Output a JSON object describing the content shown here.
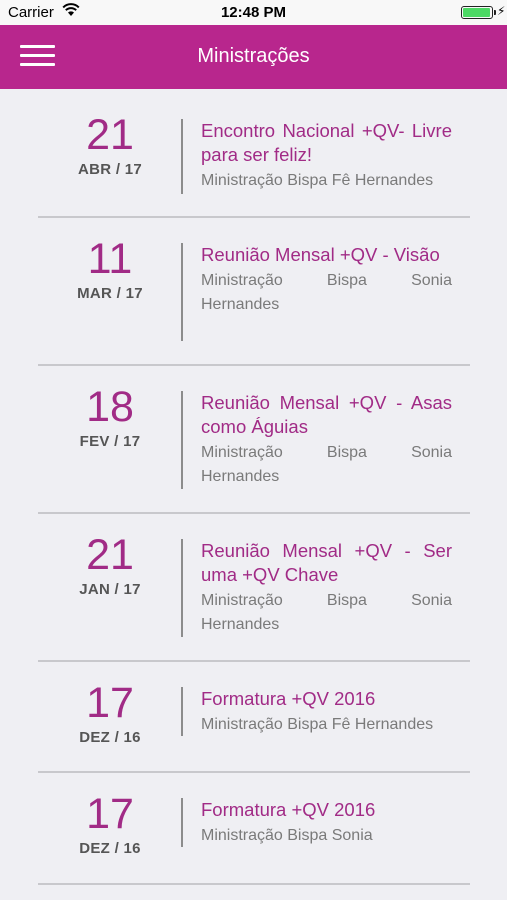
{
  "status_bar": {
    "carrier": "Carrier",
    "time": "12:48 PM"
  },
  "nav": {
    "title": "Ministrações"
  },
  "items": [
    {
      "day": "21",
      "month": "ABR / 17",
      "title": "Encontro Nacional +QV- Livre para ser feliz!",
      "subtitle": "Ministração Bispa Fê Hernandes"
    },
    {
      "day": "11",
      "month": "MAR / 17",
      "title": "Reunião Mensal +QV - Visão",
      "subtitle": "Ministração Bispa Sonia Hernandes"
    },
    {
      "day": "18",
      "month": "FEV / 17",
      "title": "Reunião Mensal +QV - Asas como Águias",
      "subtitle": "Ministração Bispa Sonia Hernandes"
    },
    {
      "day": "21",
      "month": "JAN / 17",
      "title": "Reunião Mensal +QV - Ser uma +QV Chave",
      "subtitle": "Ministração Bispa Sonia Hernandes"
    },
    {
      "day": "17",
      "month": "DEZ / 16",
      "title": "Formatura +QV 2016",
      "subtitle": "Ministração Bispa Fê Hernandes"
    },
    {
      "day": "17",
      "month": "DEZ / 16",
      "title": "Formatura +QV 2016",
      "subtitle": "Ministração Bispa Sonia"
    }
  ],
  "colors": {
    "accent": "#b8268d",
    "title_text": "#a12b86",
    "background": "#efeff3"
  }
}
